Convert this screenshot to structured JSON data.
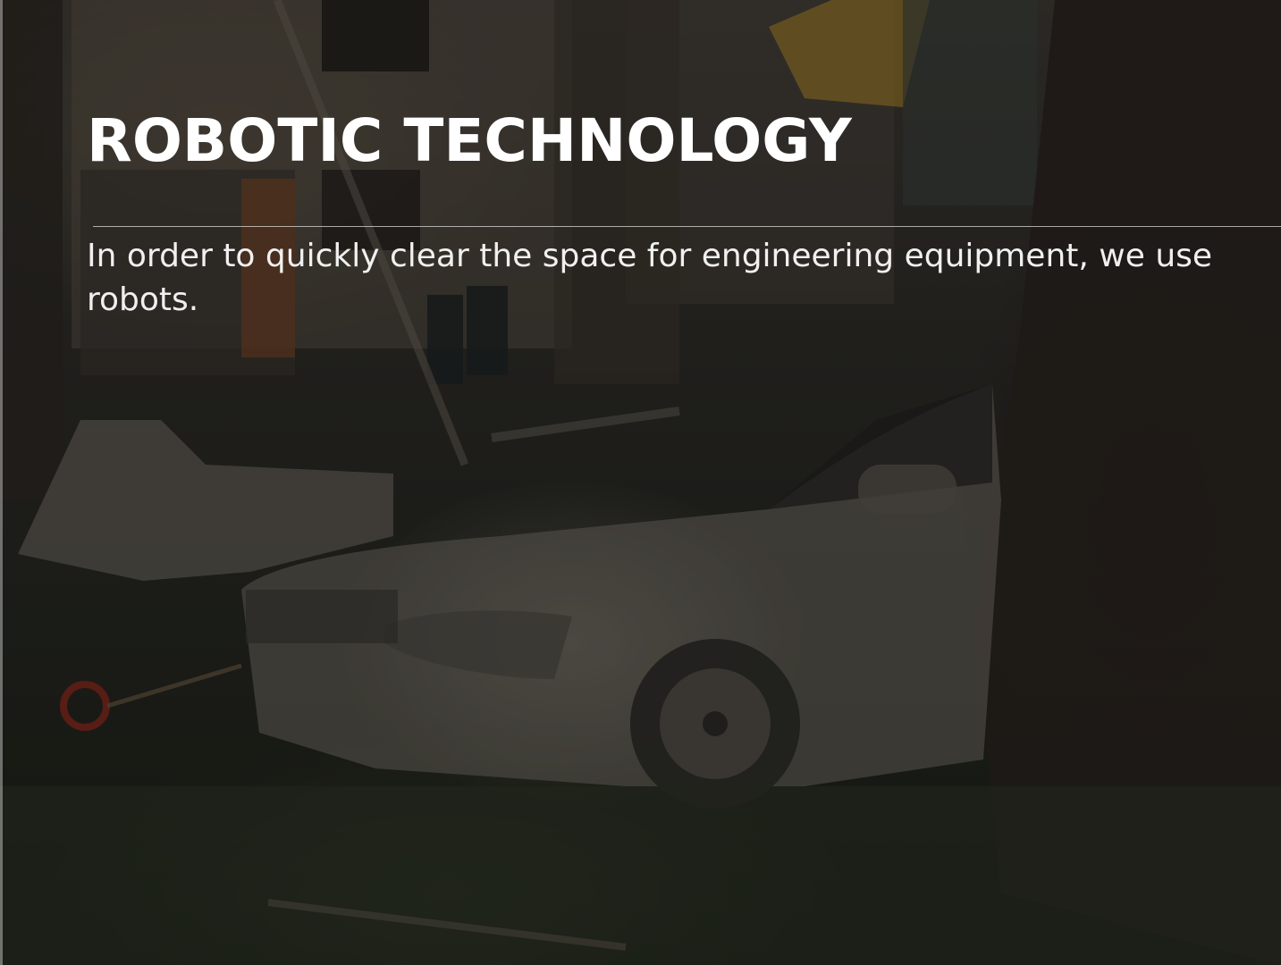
{
  "slide": {
    "title": "ROBOTIC TECHNOLOGY",
    "body": "In order to quickly clear the space for engineering equipment, we use robots."
  },
  "colors": {
    "title_text": "#ffffff",
    "body_text": "#f0f0f0",
    "divider": "#e6e6e6",
    "excavator_accent": "#c9a227"
  }
}
